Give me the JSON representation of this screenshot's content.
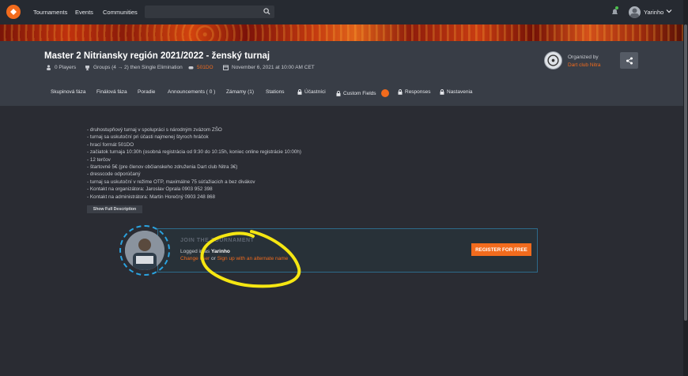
{
  "nav": {
    "links": [
      "Tournaments",
      "Events",
      "Communities"
    ],
    "search_placeholder": "",
    "user": "Yarinho"
  },
  "tournament": {
    "title": "Master 2 Nitriansky región 2021/2022 - ženský turnaj",
    "players": "0 Players",
    "format": "Groups (4 → 2) then Single Elimination",
    "game": "501DO",
    "date": "November 6, 2021 at 10:00 AM CET",
    "organized_label": "Organized by",
    "organizer": "Dart club Nitra"
  },
  "tabs": [
    "Skupinová fáza",
    "Finálová fáza",
    "Poradie",
    "Announcements ( 0 )",
    "Zámamy (1)",
    "Stations",
    "Účastníci",
    "Custom Fields",
    "Responses",
    "Nastavenia"
  ],
  "description": [
    "- druhostupňový turnaj v spolupráci s národným zvázom ZŠO",
    "- turnaj sa uskutoční pri účasti najmenej štyroch hráčok",
    "- hrací formát 501DO",
    "- začiatok turnaja 10:30h (osobná registrácia od 9:30 do 10:15h, koniec online registrácie 10:00h)",
    "- 12 terčov",
    "- štartovné 5€ (pre členov občianskeho združenia Dart club Nitra 3€)",
    "- dresscode odporúčaný",
    "- turnaj sa uskutoční v režime OTP, maximálne 75 súťažiacich a bez divákov",
    "- Kontakt na organizátora: Jaroslav Oprala 0903 952 398",
    "- Kontakt na administrátora: Martin Horečný 0903 248 868"
  ],
  "show_full": "Show Full Description",
  "join": {
    "title": "JOIN THE TOURNAMENT",
    "logged_prefix": "Logged in as",
    "user": "Yarinho",
    "change_user": "Change user",
    "or": "or",
    "signup_alt": "Sign up with an alternate name",
    "register": "REGISTER FOR FREE"
  },
  "colors": {
    "accent": "#f26b1d",
    "highlight_scribble": "#f5e612",
    "ring": "#2aa3e0"
  }
}
